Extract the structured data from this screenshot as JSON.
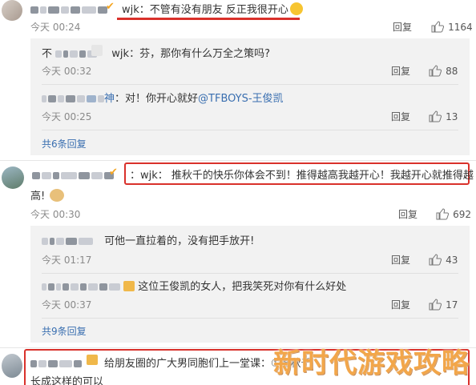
{
  "c1": {
    "text": "wjk：不管有没有朋友 反正我很开心",
    "time": "今天 00:24",
    "reply": "回复",
    "likes": "1164",
    "sub1": {
      "name": "不",
      "text": "wjk：芬，那你有什么万全之策吗?",
      "time": "今天 00:32",
      "reply": "回复",
      "likes": "88"
    },
    "sub2": {
      "name": "神",
      "text": "：对！你开心就好",
      "mention": "@TFBOYS-王俊凯",
      "time": "今天 00:25",
      "reply": "回复",
      "likes": "13"
    },
    "more": "共6条回复"
  },
  "c2": {
    "text": "：wjk： 推秋千的快乐你体会不到！推得越高我越开心！我越开心就推得越",
    "text2": "高!",
    "time": "今天 00:30",
    "reply": "回复",
    "likes": "692",
    "sub1": {
      "text": "可他一直拉着的，没有把手放开!",
      "time": "今天 01:17",
      "reply": "回复",
      "likes": "43"
    },
    "sub2": {
      "text": "这位王俊凯的女人，把我笑死对你有什么好处",
      "time": "今天 00:37",
      "reply": "回复",
      "likes": "17"
    },
    "more": "共9条回复"
  },
  "c3": {
    "text": "给朋友圈的广大男同胞们上一堂课：①推秋千",
    "text2": "长成这样的可以"
  },
  "watermark": "新时代游戏攻略",
  "colors": {
    "highlight": "#d9312b",
    "link": "#3a6fb0",
    "reply_bg": "#f2f2f2",
    "watermark": "#f2a64a"
  },
  "icons": [
    "avatar",
    "verified-badge-icon",
    "grin-emoji-icon",
    "doge-emoji-icon",
    "thumb-up-icon",
    "vip-badge-icon"
  ]
}
